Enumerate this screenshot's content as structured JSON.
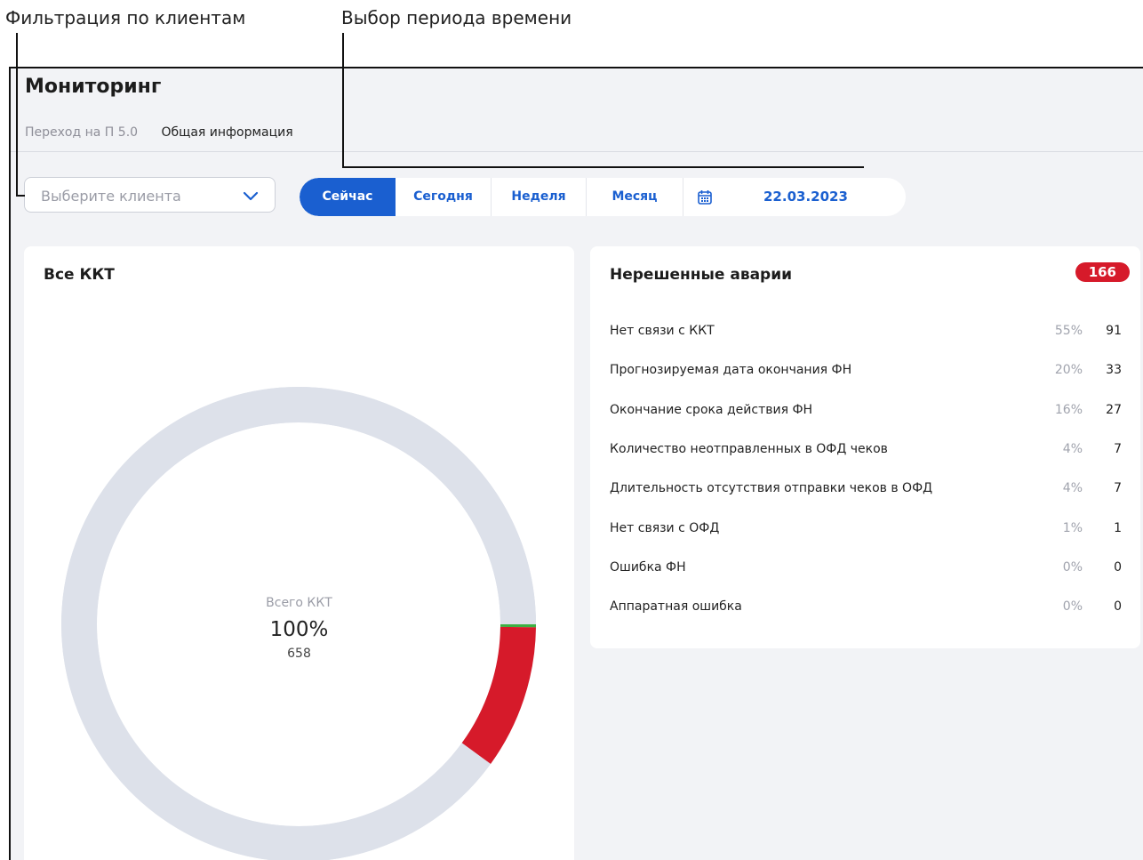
{
  "annotations": {
    "client_filter": "Фильтрация по клиентам",
    "period_select": "Выбор периода времени"
  },
  "header": {
    "title": "Мониторинг",
    "tabs": [
      {
        "label": "Переход на П 5.0",
        "active": false
      },
      {
        "label": "Общая информация",
        "active": true
      }
    ]
  },
  "filters": {
    "client_placeholder": "Выберите клиента",
    "periods": [
      {
        "label": "Сейчас",
        "active": true
      },
      {
        "label": "Сегодня",
        "active": false
      },
      {
        "label": "Неделя",
        "active": false
      },
      {
        "label": "Месяц",
        "active": false
      }
    ],
    "date": "22.03.2023",
    "calendar_icon": "calendar-icon"
  },
  "kkt_card": {
    "title": "Все ККТ",
    "center_label": "Всего ККТ",
    "center_percent": "100%",
    "center_total": "658"
  },
  "alarms_card": {
    "title": "Нерешенные аварии",
    "badge": "166",
    "rows": [
      {
        "label": "Нет связи с ККТ",
        "percent": "55%",
        "count": "91"
      },
      {
        "label": "Прогнозируемая дата окончания ФН",
        "percent": "20%",
        "count": "33"
      },
      {
        "label": "Окончание срока действия ФН",
        "percent": "16%",
        "count": "27"
      },
      {
        "label": "Количество неотправленных в ОФД чеков",
        "percent": "4%",
        "count": "7"
      },
      {
        "label": "Длительность отсутствия отправки чеков в ОФД",
        "percent": "4%",
        "count": "7"
      },
      {
        "label": "Нет связи с ОФД",
        "percent": "1%",
        "count": "1"
      },
      {
        "label": "Ошибка ФН",
        "percent": "0%",
        "count": "0"
      },
      {
        "label": "Аппаратная ошибка",
        "percent": "0%",
        "count": "0"
      }
    ]
  },
  "colors": {
    "accent": "#1a5fd0",
    "alarm": "#d61a2a",
    "ok": "#3cb043",
    "ring_base": "#dde1ea"
  },
  "chart_data": {
    "type": "pie",
    "segments": [
      {
        "value": 0.2,
        "color": "#3cb043"
      },
      {
        "value": 9.8,
        "color": "#d61a2a"
      },
      {
        "value": 90.0,
        "color": "#dde1ea"
      }
    ]
  }
}
